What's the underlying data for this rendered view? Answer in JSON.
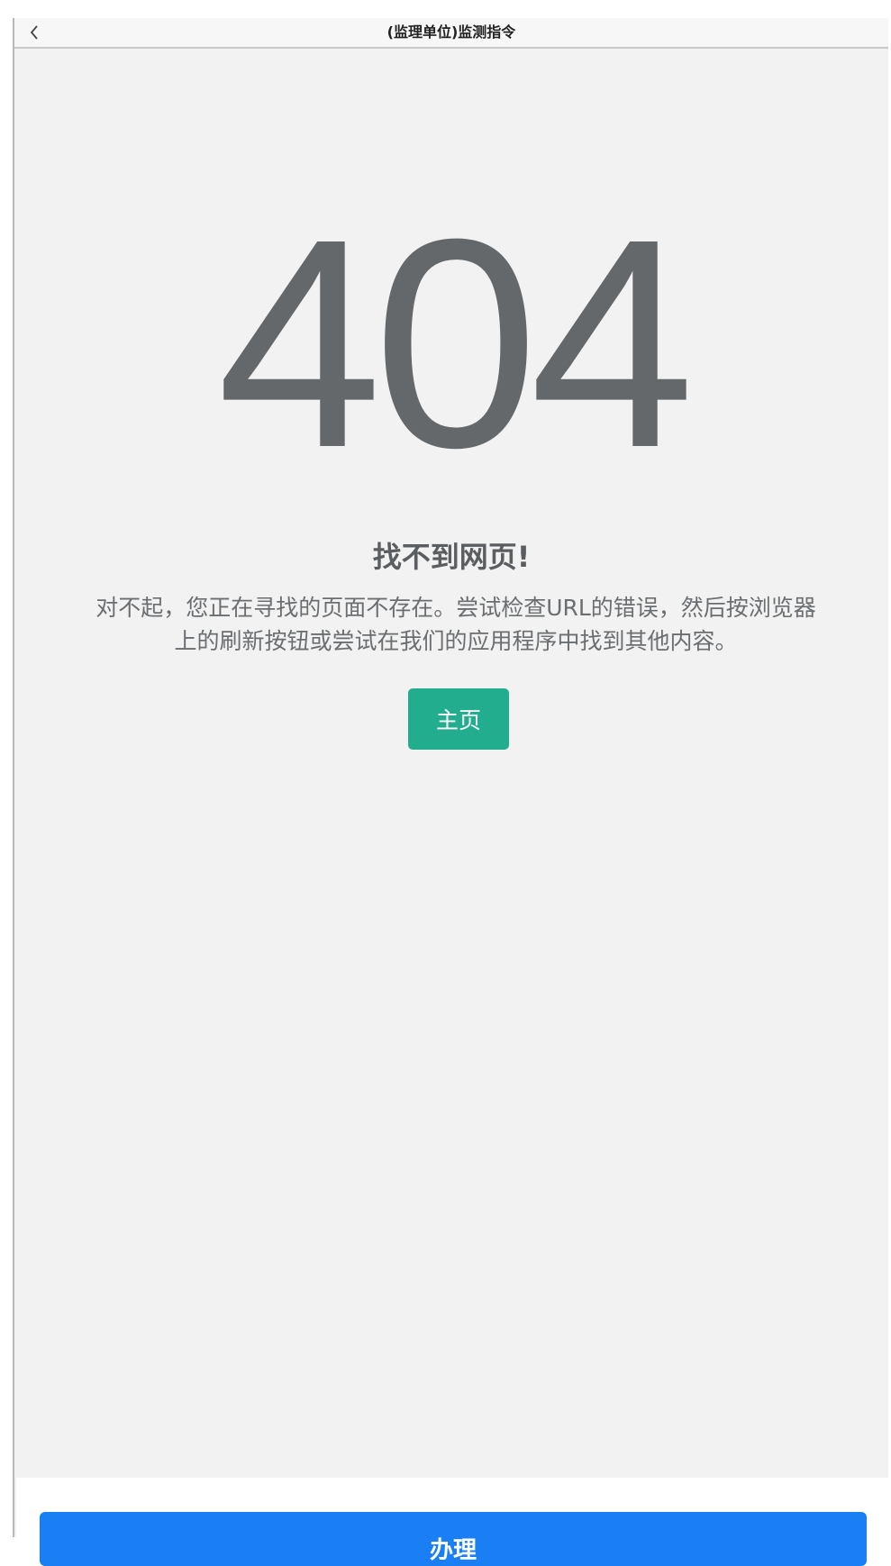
{
  "navbar": {
    "back_icon": "chevron-left-icon",
    "title": "(监理单位)监测指令"
  },
  "error": {
    "code": "404",
    "heading": "找不到网页!",
    "description": "对不起，您正在寻找的页面不存在。尝试检查URL的错误，然后按浏览器上的刷新按钮或尝试在我们的应用程序中找到其他内容。",
    "home_label": "主页"
  },
  "footer": {
    "submit_label": "办理"
  },
  "colors": {
    "home_button": "#22ae8e",
    "submit_button": "#1a7ef5",
    "error_code": "#65686b",
    "page_background": "#f2f2f2"
  }
}
